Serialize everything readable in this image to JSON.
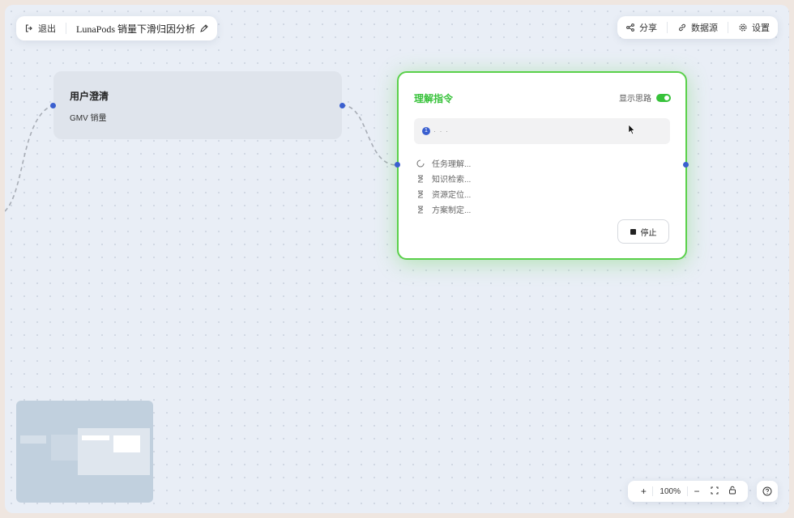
{
  "header": {
    "exit_label": "退出",
    "doc_title": "LunaPods 销量下滑归因分析"
  },
  "toolbar": {
    "share_label": "分享",
    "datasource_label": "数据源",
    "settings_label": "设置"
  },
  "nodes": {
    "clarify": {
      "title": "用户澄清",
      "subtitle": "GMV 销量"
    },
    "understand": {
      "title": "理解指令",
      "think_label": "显示思路",
      "think_enabled": true,
      "input_step": "1",
      "input_dots": "· · ·",
      "steps": [
        {
          "label": "任务理解...",
          "icon": "spinner-icon"
        },
        {
          "label": "知识检索...",
          "icon": "hourglass-icon"
        },
        {
          "label": "资源定位...",
          "icon": "hourglass-icon"
        },
        {
          "label": "方案制定...",
          "icon": "hourglass-icon"
        }
      ],
      "stop_label": "停止"
    }
  },
  "zoom": {
    "plus": "+",
    "value": "100%",
    "minus": "−"
  },
  "colors": {
    "accent_green": "#37c23a",
    "handle_blue": "#3a5fcf",
    "canvas_bg": "#e9eef6"
  }
}
